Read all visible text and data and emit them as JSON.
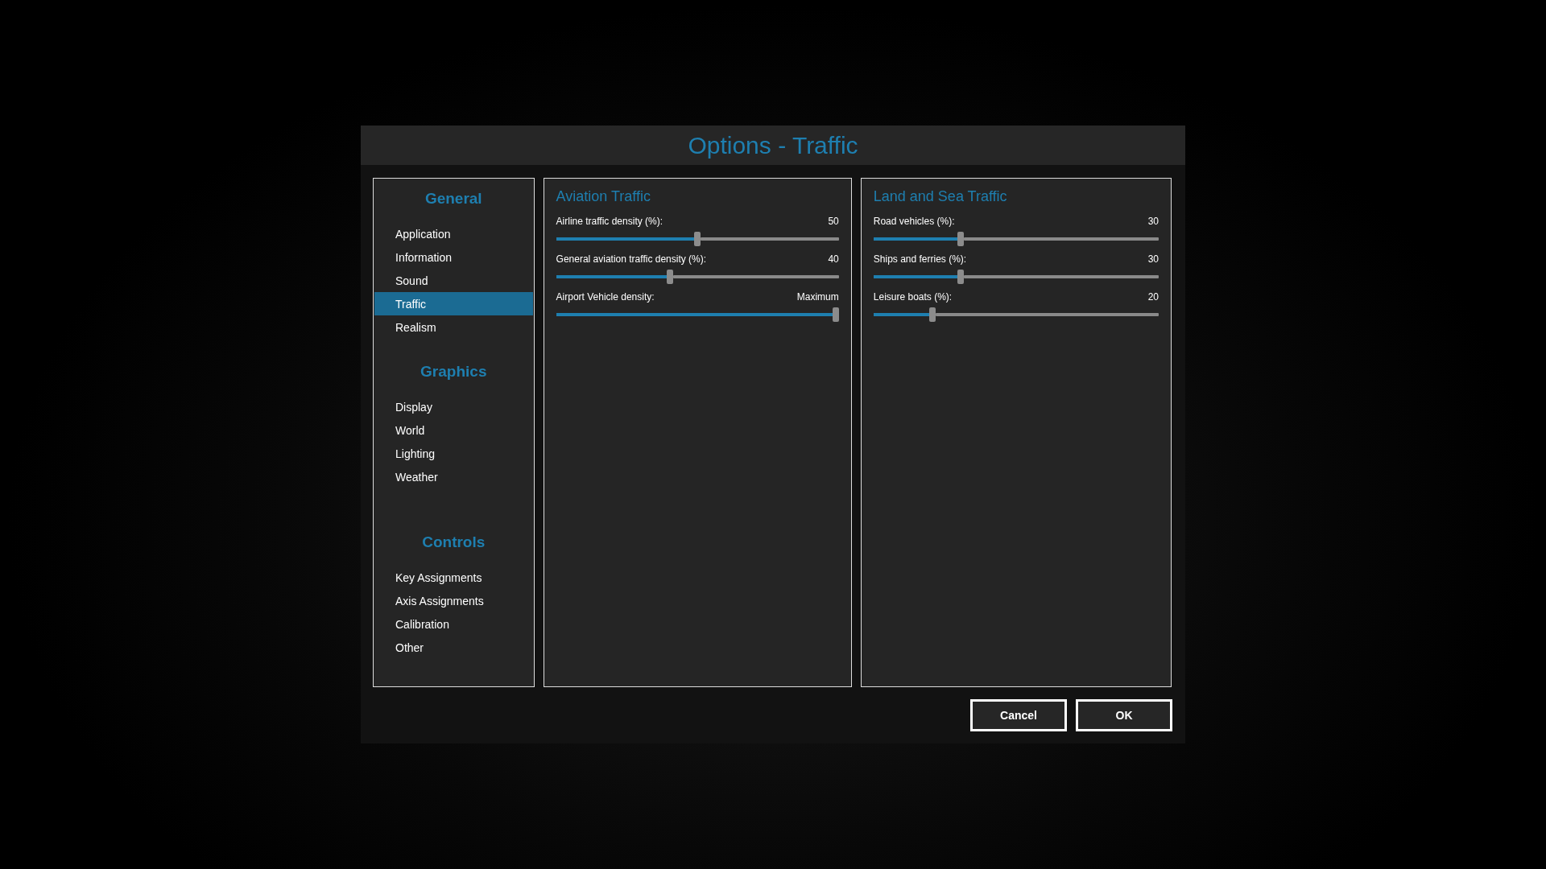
{
  "window": {
    "title": "Options - Traffic"
  },
  "sidebar": {
    "groups": [
      {
        "heading": "General",
        "items": [
          {
            "label": "Application",
            "selected": false
          },
          {
            "label": "Information",
            "selected": false
          },
          {
            "label": "Sound",
            "selected": false
          },
          {
            "label": "Traffic",
            "selected": true
          },
          {
            "label": "Realism",
            "selected": false
          }
        ]
      },
      {
        "heading": "Graphics",
        "items": [
          {
            "label": "Display",
            "selected": false
          },
          {
            "label": "World",
            "selected": false
          },
          {
            "label": "Lighting",
            "selected": false
          },
          {
            "label": "Weather",
            "selected": false
          }
        ]
      },
      {
        "heading": "Controls",
        "items": [
          {
            "label": "Key Assignments",
            "selected": false
          },
          {
            "label": "Axis Assignments",
            "selected": false
          },
          {
            "label": "Calibration",
            "selected": false
          },
          {
            "label": "Other",
            "selected": false
          }
        ]
      }
    ]
  },
  "panels": [
    {
      "title": "Aviation Traffic",
      "sliders": [
        {
          "label": "Airline traffic density (%):",
          "reading": "50",
          "level": 0.5
        },
        {
          "label": "General aviation traffic density (%):",
          "reading": "40",
          "level": 0.4
        },
        {
          "label": "Airport Vehicle density:",
          "reading": "Maximum",
          "level": 1
        }
      ]
    },
    {
      "title": "Land and Sea Traffic",
      "sliders": [
        {
          "label": "Road vehicles (%):",
          "reading": "30",
          "level": 0.3
        },
        {
          "label": "Ships and ferries (%):",
          "reading": "30",
          "level": 0.3
        },
        {
          "label": "Leisure boats (%):",
          "reading": "20",
          "level": 0.2
        }
      ]
    }
  ],
  "buttons": [
    "Cancel",
    "OK"
  ]
}
